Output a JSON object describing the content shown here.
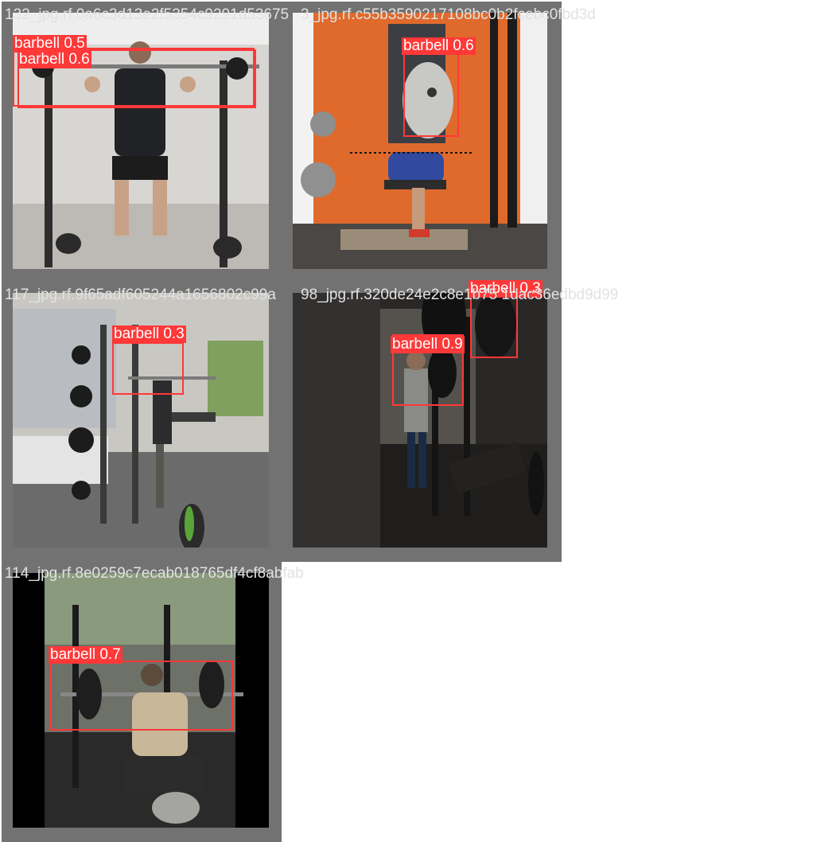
{
  "tiles": [
    {
      "filename": "132_jpg.rf.0a6c3d13e2f5354c9291d53675",
      "detections": [
        {
          "label": "barbell 0.5"
        },
        {
          "label": "barbell 0.6"
        }
      ]
    },
    {
      "filename": "3_jpg.rf.c55b3590217108bc0b2fcebc0fbd3d",
      "detections": [
        {
          "label": "barbell 0.6"
        }
      ]
    },
    {
      "filename": "117_jpg.rf.9f65adf605244a1656802c99a",
      "detections": [
        {
          "label": "barbell 0.3"
        }
      ]
    },
    {
      "filename": "98_jpg.rf.320de24e2c8e1b75 1dac36edbd9d99",
      "detections": [
        {
          "label": "barbell 0.9"
        },
        {
          "label": "barbell 0.3"
        }
      ]
    },
    {
      "filename": "114_jpg.rf.8e0259c7ecab018765df4cf8abfab",
      "detections": [
        {
          "label": "barbell 0.7"
        }
      ]
    }
  ],
  "colors": {
    "box": "#ff3838",
    "background": "#727272",
    "filename_text": "#e2e2e2"
  }
}
